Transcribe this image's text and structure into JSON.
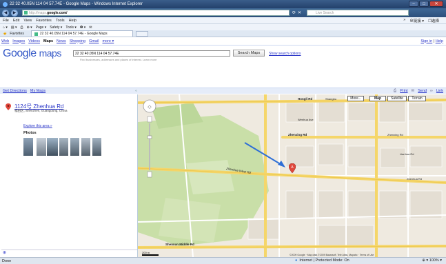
{
  "window": {
    "title": "22 32 40.05N 114 04 57.74E - Google Maps - Windows Internet Explorer",
    "controls": [
      "–",
      "□",
      "✕"
    ]
  },
  "address_bar": {
    "url_prefix": "http://maps.",
    "url_domain": "google.com/",
    "search_placeholder": "Live Search"
  },
  "menu": {
    "items": [
      "File",
      "Edit",
      "View",
      "Favorites",
      "Tools",
      "Help"
    ],
    "right_items": [
      "»",
      "⊕链接 ▾",
      "❐选择"
    ]
  },
  "command_bar": {
    "items": [
      "⌂ ▾",
      "▤ ▾",
      "⎙",
      "⊕ ▾",
      "Page ▾",
      "Safety ▾",
      "Tools ▾",
      "❷ ▾",
      "✉"
    ]
  },
  "favorites_bar": {
    "label": "Favorites",
    "tab_title": "22 32 40.05N 114 04 57.74E - Google Maps"
  },
  "google_nav": {
    "links": [
      "Web",
      "Images",
      "Videos"
    ],
    "active": "Maps",
    "links2": [
      "News",
      "Shopping",
      "Gmail",
      "more ▾"
    ],
    "signin": "Sign in",
    "help": "Help"
  },
  "search": {
    "logo_text": "Google",
    "logo_suffix": "maps",
    "query": "22 32 40.05N 114 04 57.74E",
    "hint": "Find businesses, addresses and places of interest. Learn more",
    "button": "Search Maps",
    "options": "Show search options"
  },
  "subbar": {
    "directions": "Get Directions",
    "mymaps": "My Maps",
    "collapse": "«",
    "print": "Print",
    "send": "Send",
    "link": "Link"
  },
  "result": {
    "title": "1124号 Zhenhua Rd",
    "subtitle": "福田区, Shenzhen, Guangdong, China",
    "explore": "Explore this area »",
    "photos_header": "Photos"
  },
  "map": {
    "types": [
      "More...",
      "Map",
      "Satellite",
      "Terrain"
    ],
    "streets": [
      "Hongli Rd",
      "Zhenxing Rd",
      "Zhenhua West Rd",
      "Shennan Middle Rd",
      "Lianhua Rd",
      "Hongli Rd",
      "Shangbu",
      "Wenhua Ave",
      "Zhenhua Rd",
      "Zhenxing Rd"
    ],
    "copyright": "©2009 Google · Map data ©2009 Basarsoft, Tele Atlas, Mapabc · Terms of Use",
    "scale": "200 m",
    "marker": "A"
  },
  "status": {
    "left": "Done",
    "zone": "Internet | Protected Mode: On",
    "zoom": "⊕ ▾  100% ▾"
  }
}
